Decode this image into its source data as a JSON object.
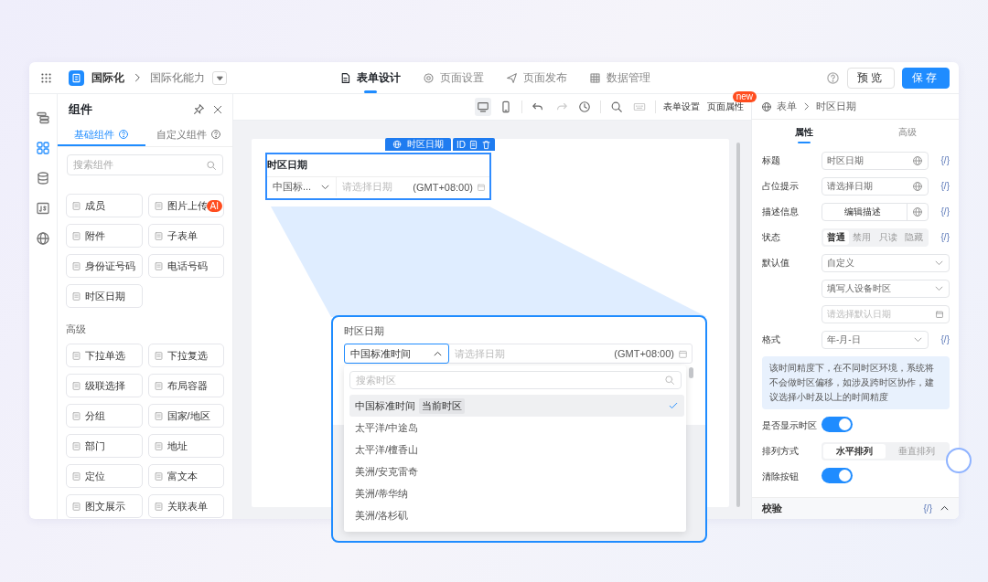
{
  "app": {
    "name": "国际化",
    "page": "国际化能力"
  },
  "nav_tabs": [
    {
      "label": "表单设计",
      "kind": "form",
      "selected": true
    },
    {
      "label": "页面设置",
      "kind": "settings",
      "selected": false
    },
    {
      "label": "页面发布",
      "kind": "publish",
      "selected": false
    },
    {
      "label": "数据管理",
      "kind": "data",
      "selected": false
    }
  ],
  "actions": [
    {
      "label": "预览",
      "kind": "secondary"
    },
    {
      "label": "保存",
      "kind": "primary"
    }
  ],
  "rail": [
    {
      "kind": "outline",
      "selected": false
    },
    {
      "kind": "components",
      "selected": true
    },
    {
      "kind": "data",
      "selected": false
    },
    {
      "kind": "script",
      "selected": false
    },
    {
      "kind": "globe",
      "selected": false
    }
  ],
  "components_panel": {
    "title": "组件",
    "tabs": [
      {
        "label": "基础组件",
        "selected": true
      },
      {
        "label": "自定义组件",
        "selected": false
      }
    ],
    "search": {
      "placeholder": "搜索组件"
    },
    "groups": [
      {
        "items": [
          {
            "label": "成员"
          },
          {
            "label": "图片上传",
            "badge": "AI"
          },
          {
            "label": "附件"
          },
          {
            "label": "子表单"
          },
          {
            "label": "身份证号码"
          },
          {
            "label": "电话号码"
          },
          {
            "label": "时区日期"
          }
        ]
      },
      {
        "title": "高级",
        "items": [
          {
            "label": "下拉单选"
          },
          {
            "label": "下拉复选"
          },
          {
            "label": "级联选择"
          },
          {
            "label": "布局容器"
          },
          {
            "label": "分组"
          },
          {
            "label": "国家/地区"
          },
          {
            "label": "部门"
          },
          {
            "label": "地址"
          },
          {
            "label": "定位"
          },
          {
            "label": "富文本"
          },
          {
            "label": "图文展示"
          },
          {
            "label": "关联表单"
          }
        ]
      }
    ]
  },
  "canvas_toolbar": {
    "devices": [
      {
        "kind": "desktop",
        "selected": true
      },
      {
        "kind": "mobile",
        "selected": false
      }
    ],
    "tools": [
      {
        "kind": "undo",
        "disabled": false
      },
      {
        "kind": "redo",
        "disabled": true
      },
      {
        "kind": "history",
        "disabled": false
      },
      {
        "kind": "search",
        "disabled": false
      },
      {
        "kind": "keyboard",
        "disabled": true
      }
    ],
    "links": [
      {
        "label": "表单设置"
      },
      {
        "label": "页面属性",
        "badge": "new"
      }
    ]
  },
  "form_field": {
    "tag": "时区日期",
    "id_label": "ID",
    "label": "时区日期",
    "timezone": "中国标...",
    "placeholder": "请选择日期",
    "offset": "(GMT+08:00)"
  },
  "callout": {
    "label": "时区日期",
    "timezone": "中国标准时间",
    "expanded": true,
    "placeholder": "请选择日期",
    "offset": "(GMT+08:00)",
    "search": {
      "placeholder": "搜索时区"
    },
    "options": [
      {
        "label": "中国标准时间",
        "tag": "当前时区",
        "selected": true
      },
      {
        "label": "太平洋/中途岛",
        "selected": false
      },
      {
        "label": "太平洋/檀香山",
        "selected": false
      },
      {
        "label": "美洲/安克雷奇",
        "selected": false
      },
      {
        "label": "美洲/蒂华纳",
        "selected": false
      },
      {
        "label": "美洲/洛杉矶",
        "selected": false
      }
    ]
  },
  "properties": {
    "breadcrumb": [
      "表单",
      "时区日期"
    ],
    "tabs": [
      {
        "label": "属性",
        "selected": true
      },
      {
        "label": "高级",
        "selected": false
      }
    ],
    "rows": [
      {
        "kind": "input",
        "label": "标题",
        "value": "时区日期",
        "code": "{/}"
      },
      {
        "kind": "input",
        "label": "占位提示",
        "value": "请选择日期",
        "code": "{/}"
      },
      {
        "kind": "button",
        "label": "描述信息",
        "value": "编辑描述",
        "code": "{/}"
      },
      {
        "kind": "segmented",
        "label": "状态",
        "options": [
          {
            "label": "普通",
            "selected": true
          },
          {
            "label": "禁用",
            "selected": false
          },
          {
            "label": "只读",
            "selected": false
          },
          {
            "label": "隐藏",
            "selected": false
          }
        ],
        "code": "{/}"
      },
      {
        "kind": "select",
        "label": "默认值",
        "value": "自定义"
      },
      {
        "kind": "select",
        "value": "填写人设备时区"
      },
      {
        "kind": "date",
        "placeholder": "请选择默认日期"
      },
      {
        "kind": "select",
        "label": "格式",
        "value": "年-月-日",
        "code": "{/}"
      },
      {
        "kind": "notice",
        "text": "该时间精度下，在不同时区环境，系统将不会做时区偏移，如涉及跨时区协作，建议选择小时及以上的时间精度"
      },
      {
        "kind": "switch",
        "label": "是否显示时区",
        "on": true
      },
      {
        "kind": "segmented",
        "label": "排列方式",
        "options": [
          {
            "label": "水平排列",
            "selected": true
          },
          {
            "label": "垂直排列",
            "selected": false
          }
        ]
      },
      {
        "kind": "switch",
        "label": "清除按钮",
        "on": true
      }
    ],
    "section": {
      "title": "校验",
      "code": "{/}",
      "expanded": true
    }
  }
}
